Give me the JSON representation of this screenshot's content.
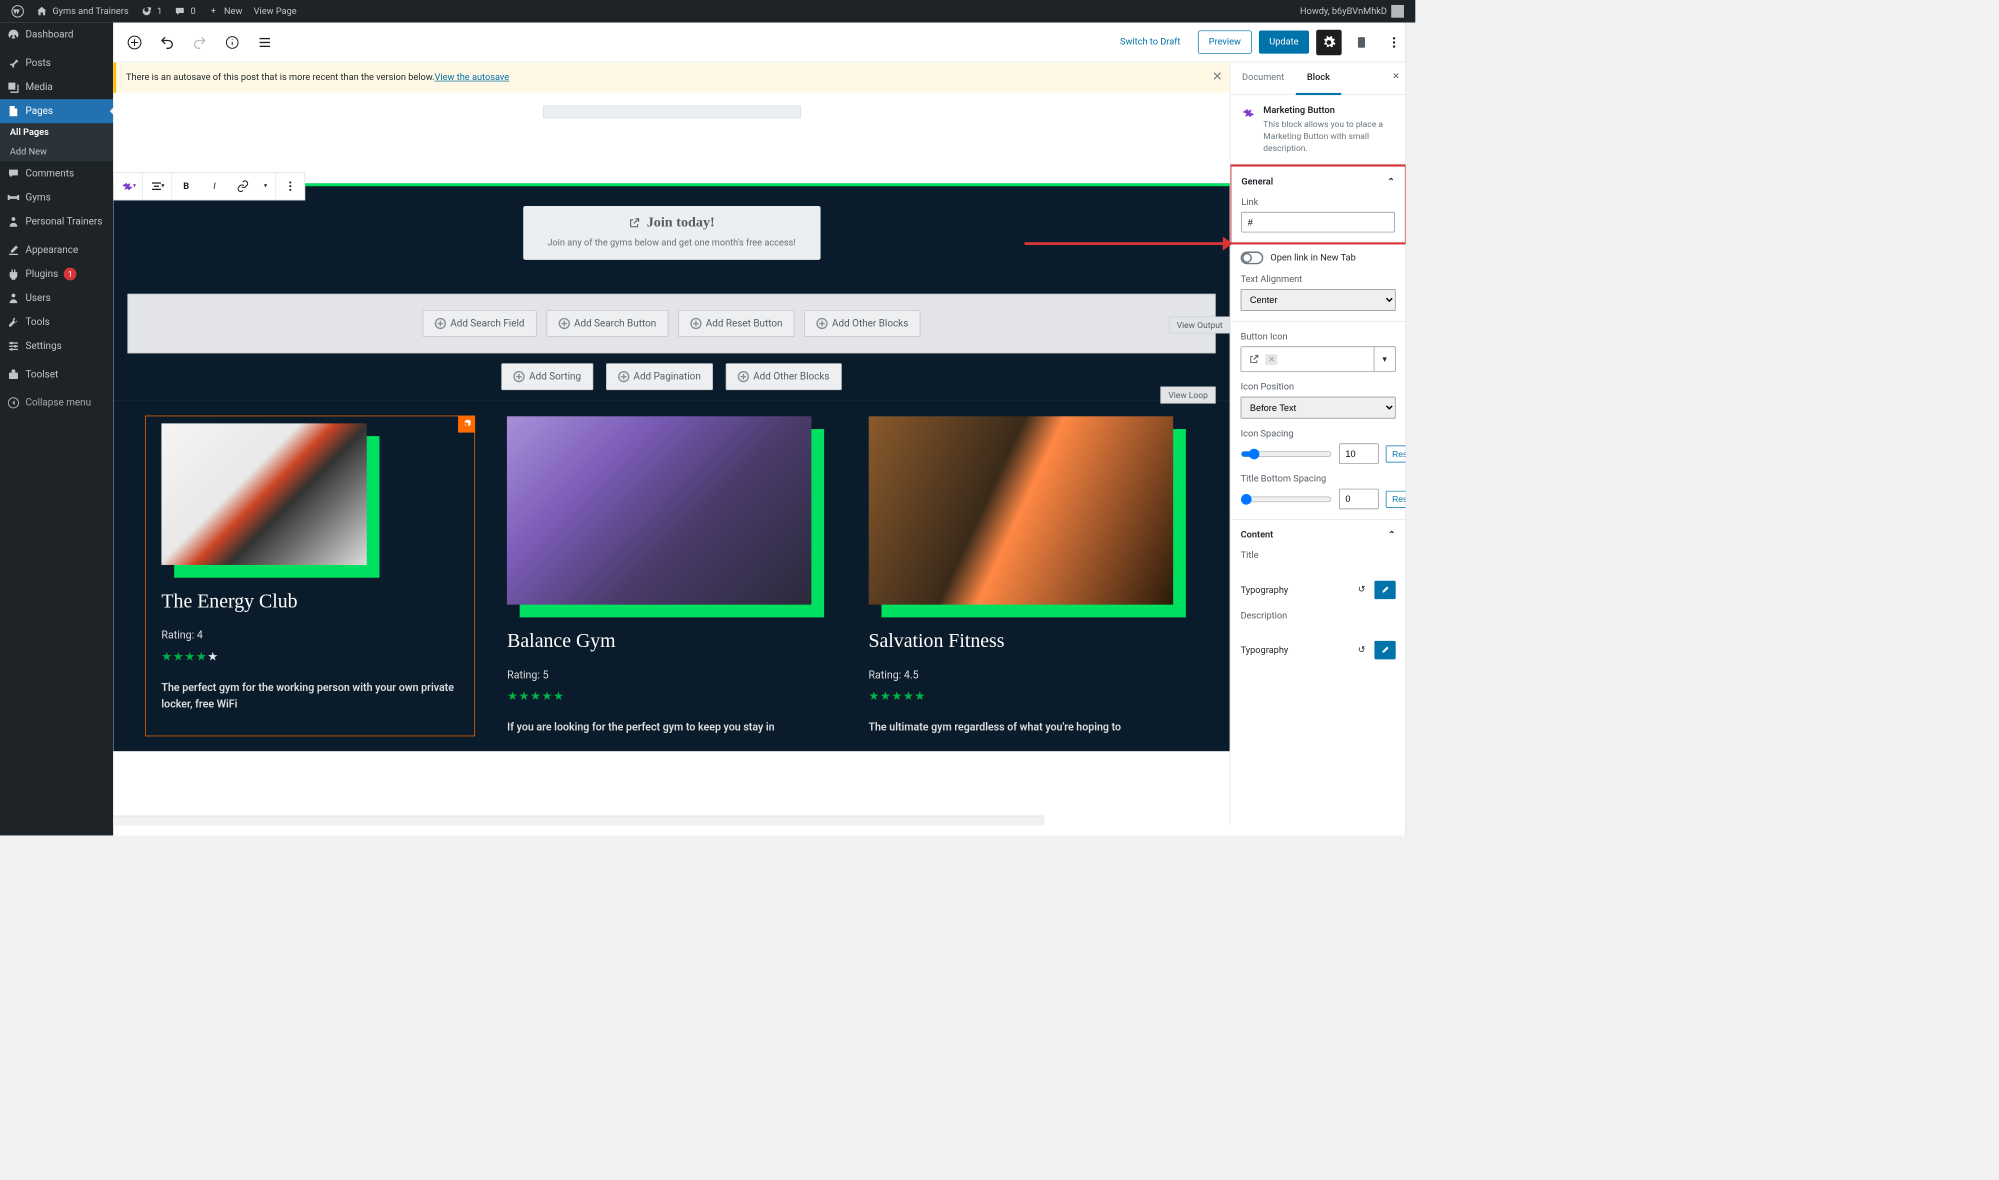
{
  "adminbar": {
    "site": "Gyms and Trainers",
    "updates": "1",
    "comments": "0",
    "new": "New",
    "view_page": "View Page",
    "howdy": "Howdy, b6yBVnMhkD"
  },
  "sidebar": {
    "items": [
      {
        "label": "Dashboard",
        "icon": "dashboard"
      },
      {
        "label": "Posts",
        "icon": "pin"
      },
      {
        "label": "Media",
        "icon": "media"
      },
      {
        "label": "Pages",
        "icon": "pages",
        "active": true
      },
      {
        "label": "Comments",
        "icon": "comment"
      },
      {
        "label": "Gyms",
        "icon": "gym"
      },
      {
        "label": "Personal Trainers",
        "icon": "person"
      },
      {
        "label": "Appearance",
        "icon": "brush"
      },
      {
        "label": "Plugins",
        "icon": "plug",
        "badge": "1"
      },
      {
        "label": "Users",
        "icon": "user"
      },
      {
        "label": "Tools",
        "icon": "tool"
      },
      {
        "label": "Settings",
        "icon": "settings"
      },
      {
        "label": "Toolset",
        "icon": "toolset"
      },
      {
        "label": "Collapse menu",
        "icon": "collapse"
      }
    ],
    "sub": {
      "all": "All Pages",
      "add": "Add New"
    }
  },
  "topbar": {
    "switch": "Switch to Draft",
    "preview": "Preview",
    "update": "Update"
  },
  "notice": {
    "text": "There is an autosave of this post that is more recent than the version below. ",
    "link": "View the autosave"
  },
  "canvas": {
    "join_title": "Join today!",
    "join_sub": "Join any of the gyms below and get one month's free access!",
    "filters": [
      "Add Search Field",
      "Add Search Button",
      "Add Reset Button",
      "Add Other Blocks"
    ],
    "sorts": [
      "Add Sorting",
      "Add Pagination",
      "Add Other Blocks"
    ],
    "view_output": "View Output",
    "view_loop": "View Loop",
    "cards": [
      {
        "title": "The Energy Club",
        "rating_label": "Rating: 4",
        "stars": 4,
        "desc": "The perfect gym for the working person with your own private locker, free WiFi"
      },
      {
        "title": "Balance Gym",
        "rating_label": "Rating: 5",
        "stars": 5,
        "desc": "If you are looking for the perfect gym to keep you stay in"
      },
      {
        "title": "Salvation Fitness",
        "rating_label": "Rating: 4.5",
        "stars": 4.5,
        "desc": "The ultimate gym regardless of what you're hoping to"
      }
    ]
  },
  "inspector": {
    "tabs": {
      "doc": "Document",
      "block": "Block"
    },
    "block_name": "Marketing Button",
    "block_desc": "This block allows you to place a Marketing Button with small description.",
    "general": {
      "title": "General",
      "link_label": "Link",
      "link_value": "#",
      "new_tab": "Open link in New Tab",
      "text_align_label": "Text Alignment",
      "text_align_value": "Center",
      "button_icon_label": "Button Icon",
      "icon_position_label": "Icon Position",
      "icon_position_value": "Before Text",
      "icon_spacing_label": "Icon Spacing",
      "icon_spacing_value": "10",
      "title_spacing_label": "Title Bottom Spacing",
      "title_spacing_value": "0",
      "reset": "Reset"
    },
    "content": {
      "title": "Content",
      "title_label": "Title",
      "typography": "Typography",
      "desc_label": "Description"
    }
  }
}
